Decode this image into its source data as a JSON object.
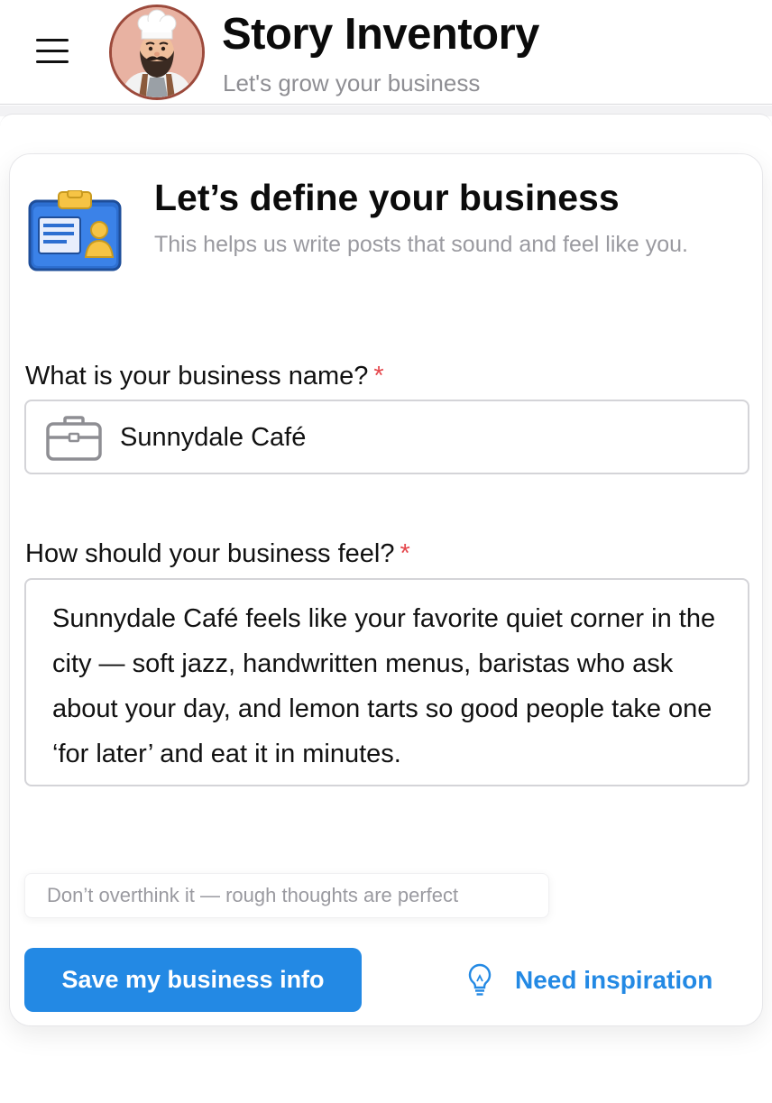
{
  "header": {
    "title": "Story Inventory",
    "subtitle": "Let's grow your business"
  },
  "card": {
    "title": "Let’s define your business",
    "subtitle": "This helps us write posts that sound and feel like you.",
    "icon": "id-badge-icon"
  },
  "form": {
    "name_label": "What is your business name?",
    "name_required": "*",
    "name_value": "Sunnydale Café",
    "feel_label": "How should your business feel?",
    "feel_required": "*",
    "feel_value": "Sunnydale Café feels like your favorite quiet corner in the city — soft jazz, handwritten menus, baristas who ask about your day, and lemon tarts so good people take one ‘for later’ and eat it in minutes.",
    "hint": "Don’t overthink it — rough thoughts are perfect"
  },
  "actions": {
    "save_label": "Save my business info",
    "inspiration_label": "Need inspiration"
  },
  "colors": {
    "accent": "#2389e4",
    "required": "#e5484d",
    "muted_text": "#9a9aa0"
  }
}
